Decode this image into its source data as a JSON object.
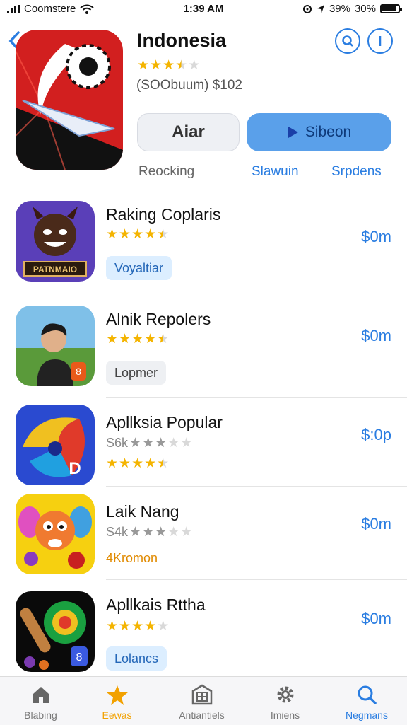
{
  "status": {
    "carrier": "Coomstere",
    "time": "1:39 AM",
    "battery_pct_a": "39%",
    "battery_pct_b": "30%"
  },
  "header": {
    "title": "Indonesia",
    "rating": 3.5,
    "subtitle": "(SOObuum) $102",
    "button_secondary": "Aiar",
    "button_primary": "Sibeon",
    "tabs": [
      "Reocking",
      "Slawuin",
      "Srpdens"
    ]
  },
  "apps": [
    {
      "name": "Raking Coplaris",
      "rating": 4.5,
      "price": "$0m",
      "chip": "Voyaltiar",
      "chip_style": "blue",
      "meta": "",
      "icon": "devil-icon",
      "icon_text": "PATNMAIO"
    },
    {
      "name": "Alnik Repolers",
      "rating": 4.5,
      "price": "$0m",
      "chip": "Lopmer",
      "chip_style": "gray",
      "meta": "",
      "icon": "boy-icon",
      "icon_text": ""
    },
    {
      "name": "Apllksia Popular",
      "rating": 4.5,
      "price": "$:0p",
      "chip": "",
      "chip_style": "",
      "meta": "S6k",
      "meta_rating": 3,
      "icon": "swirl-icon",
      "icon_text": ""
    },
    {
      "name": "Laik Nang",
      "rating": 0,
      "price": "$0m",
      "chip": "4Kromon",
      "chip_style": "orange",
      "meta": "S4k",
      "meta_rating": 3,
      "icon": "creature-icon",
      "icon_text": ""
    },
    {
      "name": "Apllkais Rttha",
      "rating": 4,
      "price": "$0m",
      "chip": "Lolancs",
      "chip_style": "blue",
      "meta": "",
      "icon": "planet-icon",
      "icon_text": ""
    }
  ],
  "tabbar": [
    {
      "label": "Blabing",
      "icon": "home-icon",
      "state": ""
    },
    {
      "label": "Eewas",
      "icon": "star-icon",
      "state": "active"
    },
    {
      "label": "Antiantiels",
      "icon": "apps-icon",
      "state": ""
    },
    {
      "label": "Imiens",
      "icon": "gear-icon",
      "state": ""
    },
    {
      "label": "Negmans",
      "icon": "search-icon",
      "state": "blue"
    }
  ],
  "colors": {
    "accent": "#2a7de1",
    "star": "#f4b400",
    "primary_button": "#5aa0ea"
  }
}
